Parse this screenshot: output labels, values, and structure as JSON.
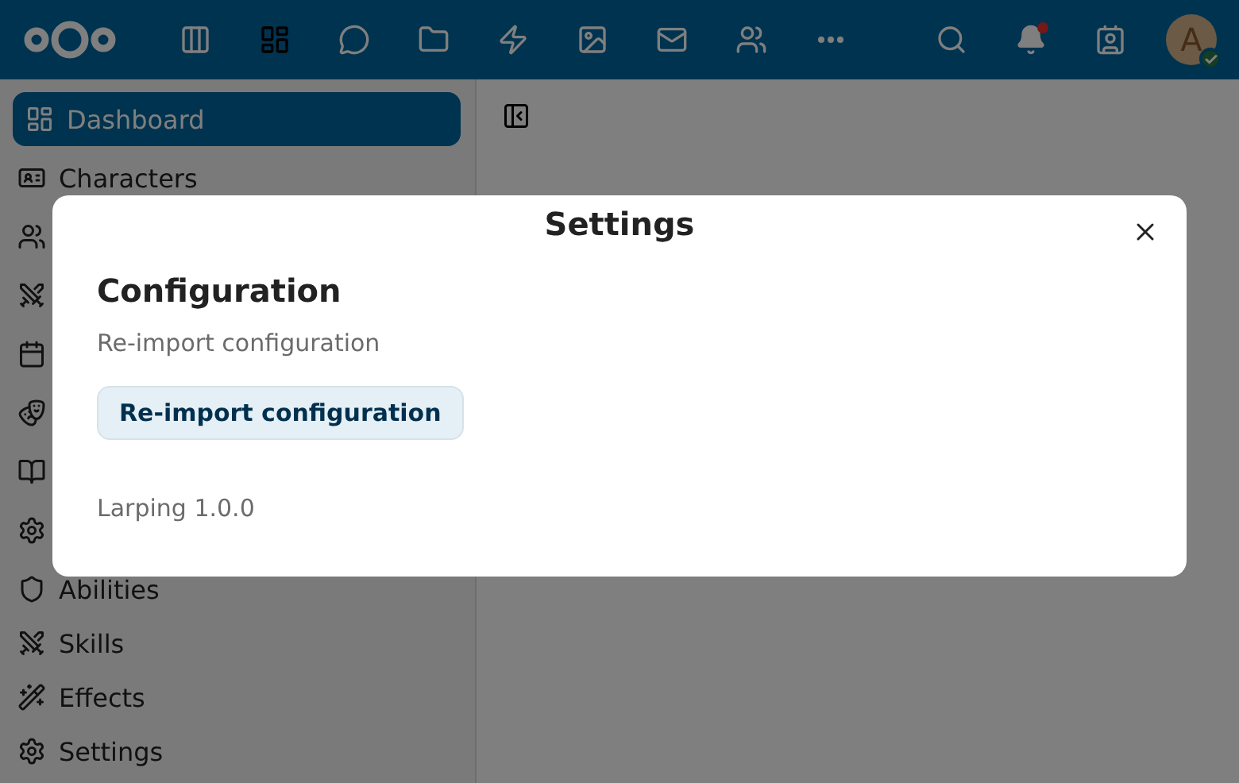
{
  "header": {
    "apps": [
      {
        "kind": "columns",
        "selected": false
      },
      {
        "kind": "dashboard",
        "selected": true
      },
      {
        "kind": "talk",
        "selected": false
      },
      {
        "kind": "files",
        "selected": false
      },
      {
        "kind": "activity",
        "selected": false
      },
      {
        "kind": "photos",
        "selected": false
      },
      {
        "kind": "mail",
        "selected": false
      },
      {
        "kind": "contacts",
        "selected": false
      },
      {
        "kind": "more",
        "selected": false
      }
    ],
    "notifications_unread": true,
    "avatar": {
      "initial": "A",
      "online": true
    }
  },
  "sidebar": {
    "items": [
      {
        "kind": "dashboard",
        "label": "Dashboard",
        "selected": true
      },
      {
        "kind": "characters",
        "label": "Characters",
        "selected": false
      },
      {
        "kind": "players",
        "selected": false
      },
      {
        "kind": "sword",
        "selected": false
      },
      {
        "kind": "calendar",
        "selected": false
      },
      {
        "kind": "mask",
        "selected": false
      },
      {
        "kind": "book",
        "selected": false
      },
      {
        "kind": "gear-outline",
        "selected": false
      },
      {
        "kind": "shield",
        "label": "Abilities",
        "selected": false
      },
      {
        "kind": "skills",
        "label": "Skills",
        "selected": false
      },
      {
        "kind": "wand",
        "label": "Effects",
        "selected": false
      },
      {
        "kind": "gear",
        "label": "Settings",
        "selected": false
      }
    ]
  },
  "dialog": {
    "title": "Settings",
    "section_title": "Configuration",
    "description": "Re-import configuration",
    "button": "Re-import configuration",
    "version": "Larping 1.0.0"
  }
}
